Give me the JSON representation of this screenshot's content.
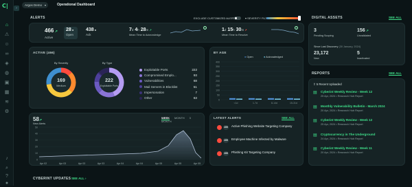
{
  "brand": {
    "logo": "C|"
  },
  "nav_icons": [
    "home-icon",
    "alert-icon",
    "people-icon",
    "link-icon",
    "shield-icon",
    "globe-icon",
    "briefcase-icon",
    "grid-icon",
    "layers-icon",
    "settings-icon",
    "bell-icon",
    "search-icon",
    "help-icon",
    "user-icon"
  ],
  "header": {
    "org": "Argos Demo",
    "title": "Operational Dashboard"
  },
  "alerts": {
    "label": "ALERTS",
    "exclude_label": "EXCLUDE CUSTOMIZED ALERTS",
    "severity_label": "SEVERITY FILTER",
    "active_count": "466",
    "active_label": "Active",
    "open_count": "28",
    "open_label": "Open",
    "ack_count": "438",
    "ack_label": "Ack",
    "mtta": "7",
    "mtta_d": "d",
    "mtta_h": "4",
    "mtta_hu": "h",
    "mtta_m": "28",
    "mtta_mu": "m",
    "mtta_label": "Mean Time to Acknowledge",
    "mttr": "1",
    "mttr_d": "d",
    "mttr_h": "15",
    "mttr_hu": "h",
    "mttr_m": "30",
    "mttr_mu": "m",
    "mttr_label": "Mean Time to Resolve",
    "colors": {
      "up": "#3fe08a",
      "down": "#ff5a4e"
    }
  },
  "active_panel": {
    "title": "ACTIVE (466)",
    "by_severity": "By Severity",
    "severity_center_value": "169",
    "severity_center_label": "Medium",
    "by_type": "By Type",
    "type_center_value": "222",
    "type_center_label": "Exploitable Ports",
    "types": [
      {
        "name": "Exploitable Ports",
        "value": "222",
        "color": "#b59cf2"
      },
      {
        "name": "Compromised Emplo...",
        "value": "93",
        "color": "#8a74d6"
      },
      {
        "name": "Vulnerabilities",
        "value": "68",
        "color": "#6b5ac1"
      },
      {
        "name": "Mail Servers in Blocklist",
        "value": "51",
        "color": "#4d3f9a"
      },
      {
        "name": "Impersonation",
        "value": "7",
        "color": "#3b3178"
      },
      {
        "name": "Other",
        "value": "63",
        "color": "#2a2456"
      }
    ],
    "severity": [
      {
        "name": "Critical",
        "value": 60,
        "color": "#ff4b3e"
      },
      {
        "name": "High",
        "value": 110,
        "color": "#ff8a2e"
      },
      {
        "name": "Medium",
        "value": 169,
        "color": "#f6c83e"
      },
      {
        "name": "Low",
        "value": 127,
        "color": "#3f8fcf"
      }
    ]
  },
  "by_age": {
    "title": "BY AGE",
    "legend_open": "Open",
    "legend_ack": "Acknowledged",
    "color_open": "#4e8ed8",
    "color_ack": "#7ad0f0",
    "y_ticks": [
      "400",
      "350",
      "300",
      "250",
      "200",
      "150",
      "100",
      "50",
      "0"
    ],
    "categories": [
      "<1d",
      "1-7d",
      "8-14d",
      "15-31d"
    ]
  },
  "timeline": {
    "count": "58",
    "trend": "↗",
    "count_label": "New Alerts",
    "tabs": [
      "WEEK",
      "MONTH",
      "3 MONTH"
    ],
    "y_ticks": [
      "50",
      "40",
      "30",
      "20",
      "10",
      "0"
    ],
    "x_ticks": [
      "Apr 02",
      "Apr 03",
      "Apr 03",
      "Apr 03",
      "Apr 04",
      "Apr 04",
      "Apr 05",
      "Apr 05",
      "Apr 05"
    ]
  },
  "latest_alerts": {
    "title": "LATEST ALERTS",
    "see_all": "SEE ALL",
    "items": [
      {
        "score": "100",
        "text": "Active Phishing Website Targeting Company"
      },
      {
        "score": "100",
        "text": "Employee Machine Infected by Malware"
      },
      {
        "score": "100",
        "text": "Phishing Kit Targeting Company"
      }
    ]
  },
  "digital_assets": {
    "title": "DIGITAL ASSETS",
    "see_all": "SEE ALL",
    "pending": "3",
    "pending_label": "Pending Scoping",
    "unvalidated": "156",
    "unvalidated_label": "Unvalidated",
    "since_label": "Since Last Discovery",
    "since_date": "(30 January, 2024)",
    "new_count": "23,172",
    "new_label": "New",
    "inactivated": "5",
    "inactivated_label": "Inactivated"
  },
  "reports": {
    "title": "REPORTS",
    "see_all": "SEE ALL",
    "recent": "5 Recent Uploaded",
    "items": [
      {
        "title": "Cyberint Weekly Review - Week 12",
        "date": "25 Apr, 2024",
        "type": "Research Hub Report"
      },
      {
        "title": "Monthly Vulnerability Bulletin - March 2024",
        "date": "20 Apr, 2024",
        "type": "Research Hub Report"
      },
      {
        "title": "Cyberint Weekly Review - Week 12",
        "date": "25 Apr, 2024",
        "type": "Research Hub Report"
      },
      {
        "title": "Cryptocurrency in The Underground",
        "date": "24 Apr, 2024",
        "type": "Research Hub Report"
      },
      {
        "title": "Cyberint Weekly Review - Week 11",
        "date": "20 Apr, 2024",
        "type": "Research Hub Report"
      }
    ]
  },
  "updates": {
    "title": "CYBERINT UPDATES",
    "see_all": "SEE ALL"
  }
}
